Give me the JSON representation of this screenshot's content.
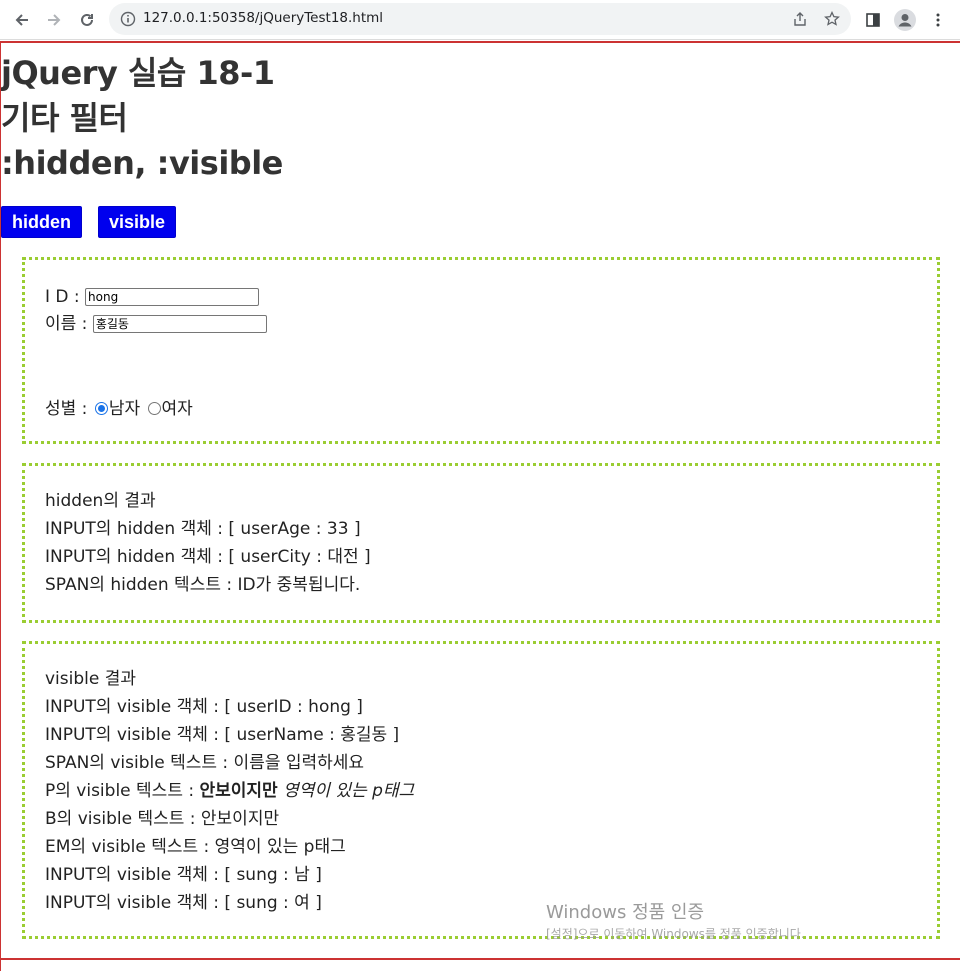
{
  "browser": {
    "url": "127.0.0.1:50358/jQueryTest18.html"
  },
  "header": {
    "line1": "jQuery 실습 18-1",
    "line2": "기타 필터",
    "line3": ":hidden, :visible"
  },
  "buttons": {
    "hidden": "hidden",
    "visible": "visible"
  },
  "form": {
    "id_label": "I D :",
    "id_value": "hong",
    "name_label": "이름 :",
    "name_value": "홍길동",
    "gender_label": "성별 :",
    "gender_options": [
      "남자",
      "여자"
    ],
    "gender_selected": "남자"
  },
  "hidden_result": {
    "title": "hidden의 결과",
    "lines": [
      "INPUT의 hidden 객체 : [ userAge : 33 ]",
      "INPUT의 hidden 객체 : [ userCity : 대전 ]",
      "SPAN의 hidden 텍스트 : ID가 중복됩니다."
    ]
  },
  "visible_result": {
    "title": "visible 결과",
    "lines": [
      "INPUT의 visible 객체 : [ userID : hong ]",
      "INPUT의 visible 객체 : [ userName : 홍길동 ]",
      "SPAN의 visible 텍스트 : 이름을 입력하세요"
    ],
    "p_prefix": "P의 visible 텍스트 : ",
    "p_bold": "안보이지만",
    "p_italic": " 영역이 있는 p태그",
    "lines2": [
      "B의 visible 텍스트 : 안보이지만",
      "EM의 visible 텍스트 : 영역이 있는 p태그",
      "INPUT의 visible 객체 : [ sung : 남 ]",
      "INPUT의 visible 객체 : [ sung : 여 ]"
    ]
  },
  "watermark": {
    "line1": "Windows 정품 인증",
    "line2": "[설정]으로 이동하여 Windows를 정품 인증합니다."
  }
}
